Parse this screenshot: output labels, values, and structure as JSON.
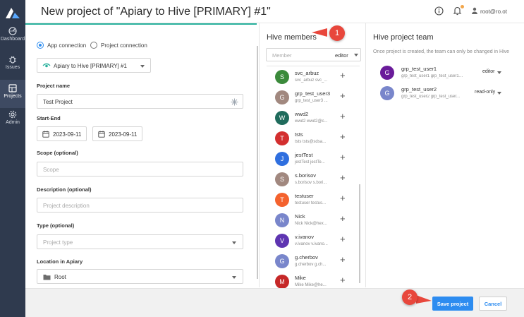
{
  "header": {
    "title": "New project of \"Apiary to Hive [PRIMARY] #1\"",
    "user": "root@ro.ot",
    "info_icon": "info-icon",
    "bell_icon": "bell-icon",
    "user_icon": "user-icon",
    "notification_color": "#f2a64a"
  },
  "sidebar": {
    "items": [
      {
        "label": "Dashboard",
        "icon": "dashboard-icon"
      },
      {
        "label": "Issues",
        "icon": "bug-icon"
      },
      {
        "label": "Projects",
        "icon": "projects-icon",
        "active": true
      },
      {
        "label": "Admin",
        "icon": "gear-icon"
      }
    ]
  },
  "form": {
    "connection_mode": {
      "app": "App connection",
      "project": "Project connection",
      "selected": "app"
    },
    "connection_value": "Apiary to Hive [PRIMARY] #1",
    "project_name_label": "Project name",
    "project_name_value": "Test Project",
    "start_end_label": "Start-End",
    "start_date": "2023-09-11",
    "end_date": "2023-09-11",
    "scope_label": "Scope (optional)",
    "scope_placeholder": "Scope",
    "description_label": "Description (optional)",
    "description_placeholder": "Project description",
    "type_label": "Type (optional)",
    "type_placeholder": "Project type",
    "location_label": "Location in Apiary",
    "location_value": "Root"
  },
  "members": {
    "title": "Hive members",
    "filter_placeholder": "Member",
    "filter_role": "editor",
    "list": [
      {
        "initial": "S",
        "name": "svc_arbuz",
        "sub": "svc_arbuz svc_...",
        "color": "#3b8a3b"
      },
      {
        "initial": "G",
        "name": "grp_test_user3",
        "sub": "grp_test_user3 ...",
        "color": "#a1887f"
      },
      {
        "initial": "W",
        "name": "wwd2",
        "sub": "wwd2 wwd2@c...",
        "color": "#1f6b5c"
      },
      {
        "initial": "T",
        "name": "tsts",
        "sub": "tsts tsts@sdsa...",
        "color": "#d32f2f"
      },
      {
        "initial": "J",
        "name": "jestTest",
        "sub": "jestTest jestTe...",
        "color": "#2f6fdf"
      },
      {
        "initial": "S",
        "name": "s.borisov",
        "sub": "s.borisov s.bori...",
        "color": "#a1887f"
      },
      {
        "initial": "T",
        "name": "testuser",
        "sub": "testuser testus...",
        "color": "#f4622e"
      },
      {
        "initial": "N",
        "name": "Nick",
        "sub": "Nick Nick@hex...",
        "color": "#7986cb"
      },
      {
        "initial": "V",
        "name": "v.ivanov",
        "sub": "v.ivanov v.ivano...",
        "color": "#5e35b1"
      },
      {
        "initial": "G",
        "name": "g.cherbov",
        "sub": "g.cherbov g.ch...",
        "color": "#7986cb"
      },
      {
        "initial": "M",
        "name": "Mike",
        "sub": "Mike Mike@he...",
        "color": "#c62828"
      }
    ]
  },
  "team": {
    "title": "Hive project team",
    "note": "Once project is created, the team can only be changed in Hive",
    "list": [
      {
        "initial": "G",
        "name": "grp_test_user1",
        "sub": "grp_test_user1 grp_test_user1@...",
        "role": "editor",
        "color": "#6a1b9a"
      },
      {
        "initial": "G",
        "name": "grp_test_user2",
        "sub": "grp_test_user2 grp_test_user...",
        "role": "read-only",
        "color": "#7986cb"
      }
    ]
  },
  "footer": {
    "save": "Save project",
    "cancel": "Cancel"
  },
  "markers": [
    "1",
    "2"
  ],
  "colors": {
    "accent": "#2d8cf0",
    "sidebar": "#2f3a4e",
    "teal_line": "#27b09c",
    "marker": "#e8473c"
  }
}
